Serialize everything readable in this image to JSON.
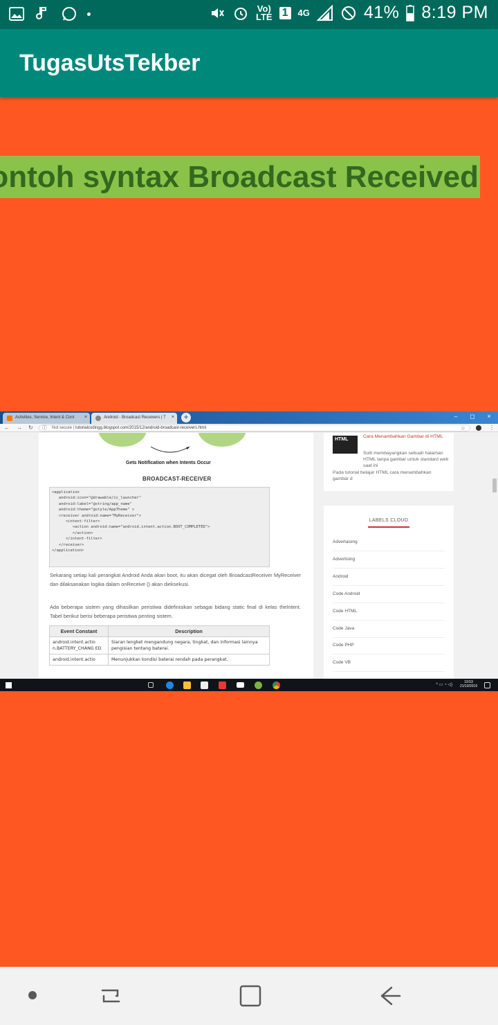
{
  "status_bar": {
    "battery": "41%",
    "time": "8:19 PM",
    "volte": "Vo)\nLTE",
    "sim": "1",
    "network": "4G"
  },
  "app_bar": {
    "title": "TugasUtsTekber"
  },
  "heading": {
    "text": "Contoh syntax Broadcast Received"
  },
  "embedded_screenshot": {
    "tabs": [
      {
        "label": "Activities, Service, Intent & Cont",
        "close": "×"
      },
      {
        "label": "Android - Broadcast Receivers | T",
        "close": "×"
      }
    ],
    "new_tab": "+",
    "window_controls": [
      "–",
      "◻",
      "×"
    ],
    "address": {
      "security": "Not secure",
      "url": "tutorialcodingg.blogspot.com/2015/12/android-broadcast-receivers.html"
    },
    "article": {
      "diagram_caption": "Gets Notification when Intents Occur",
      "section_title": "BROADCAST-RECEIVER",
      "code_lines": [
        "<application",
        "   android:icon=\"@drawable/ic_launcher\"",
        "   android:label=\"@string/app_name\"",
        "   android:theme=\"@style/AppTheme\" >",
        "   <receiver android:name=\"MyReceiver\">",
        "",
        "      <intent-filter>",
        "         <action android:name=\"android.intent.action.BOOT_COMPLETED\">",
        "         </action>",
        "      </intent-filter>",
        "",
        "   </receiver>",
        "</application>"
      ],
      "paragraph1": "Sekarang setiap kali perangkat Android Anda akan boot, itu akan dicegat oleh BroadcastReceiver MyReceiver dan dilaksanakan logika dalam onReceive () akan dieksekusi.",
      "paragraph2": "Ada beberapa sistem yang dihasilkan peristiwa didefinisikan sebagai bidang static final di kelas theIntent. Tabel berikut berisi beberapa peristiwa penting sistem.",
      "table": {
        "headers": [
          "Event Constant",
          "Description"
        ],
        "rows": [
          [
            "android.intent.actio n.BATTERY_CHANG ED",
            "Siaran lengket mengandung negara, tingkat, dan informasi lainnya pengisian tentang baterai."
          ],
          [
            "android.intent.actio",
            "Menunjukkan kondisi baterai rendah pada perangkat."
          ]
        ]
      }
    },
    "sidebar_post": {
      "badge": "HTML",
      "title": "Cara Menambahkan Gambar di HTML",
      "desc": "Sulit membayangkan sebuah halaman HTML tanpa gambar untuk standard web saat ini",
      "desc2": "Pada tutorial belajar HTML cara menambahkan gambar d"
    },
    "labels_cloud": {
      "heading": "LABELS CLOUD",
      "items": [
        "Advertaising",
        "Advertising",
        "Android",
        "Code Android",
        "Code HTML",
        "Code Java",
        "Code PHP",
        "Code VB"
      ]
    },
    "taskbar": {
      "time": "19:53",
      "date": "21/10/2019"
    }
  },
  "colors": {
    "status_bar": "#00695c",
    "app_bar": "#00897b",
    "background": "#ff5722",
    "heading_bg": "#8bc34a",
    "heading_text": "#33691e"
  }
}
